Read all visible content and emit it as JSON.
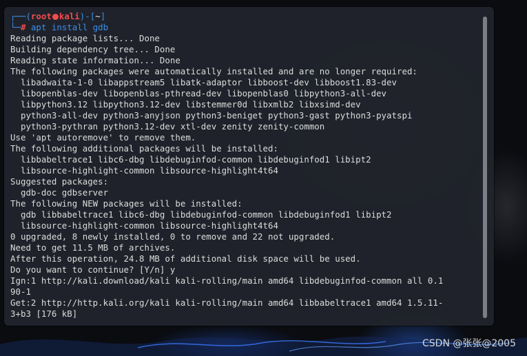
{
  "prompt": {
    "bracket_open": "┌──(",
    "user": "root",
    "host": "kali",
    "bracket_mid": ")-[",
    "path": "~",
    "bracket_close": "]",
    "prompt_char_prefix": "└─",
    "prompt_char": "#",
    "command": "apt install gdb"
  },
  "output_lines": [
    "Reading package lists... Done",
    "Building dependency tree... Done",
    "Reading state information... Done",
    "The following packages were automatically installed and are no longer required:",
    "  libadwaita-1-0 libappstream5 libatk-adaptor libboost-dev libboost1.83-dev",
    "  libopenblas-dev libopenblas-pthread-dev libopenblas0 libpython3-all-dev",
    "  libpython3.12 libpython3.12-dev libstemmer0d libxmlb2 libxsimd-dev",
    "  python3-all-dev python3-anyjson python3-beniget python3-gast python3-pyatspi",
    "  python3-pythran python3.12-dev xtl-dev zenity zenity-common",
    "Use 'apt autoremove' to remove them.",
    "The following additional packages will be installed:",
    "  libbabeltrace1 libc6-dbg libdebuginfod-common libdebuginfod1 libipt2",
    "  libsource-highlight-common libsource-highlight4t64",
    "Suggested packages:",
    "  gdb-doc gdbserver",
    "The following NEW packages will be installed:",
    "  gdb libbabeltrace1 libc6-dbg libdebuginfod-common libdebuginfod1 libipt2",
    "  libsource-highlight-common libsource-highlight4t64",
    "0 upgraded, 8 newly installed, 0 to remove and 22 not upgraded.",
    "Need to get 11.5 MB of archives.",
    "After this operation, 24.8 MB of additional disk space will be used.",
    "Do you want to continue? [Y/n] y",
    "Ign:1 http://kali.download/kali kali-rolling/main amd64 libdebuginfod-common all 0.1",
    "90-1",
    "Get:2 http://http.kali.org/kali kali-rolling/main amd64 libbabeltrace1 amd64 1.5.11-",
    "3+b3 [176 kB]"
  ],
  "watermark": "CSDN @张张@2005",
  "colors": {
    "terminal_bg": "#22252d",
    "prompt_blue": "#3b8eea",
    "prompt_red": "#f14c4c",
    "text": "#dcdcdc"
  }
}
